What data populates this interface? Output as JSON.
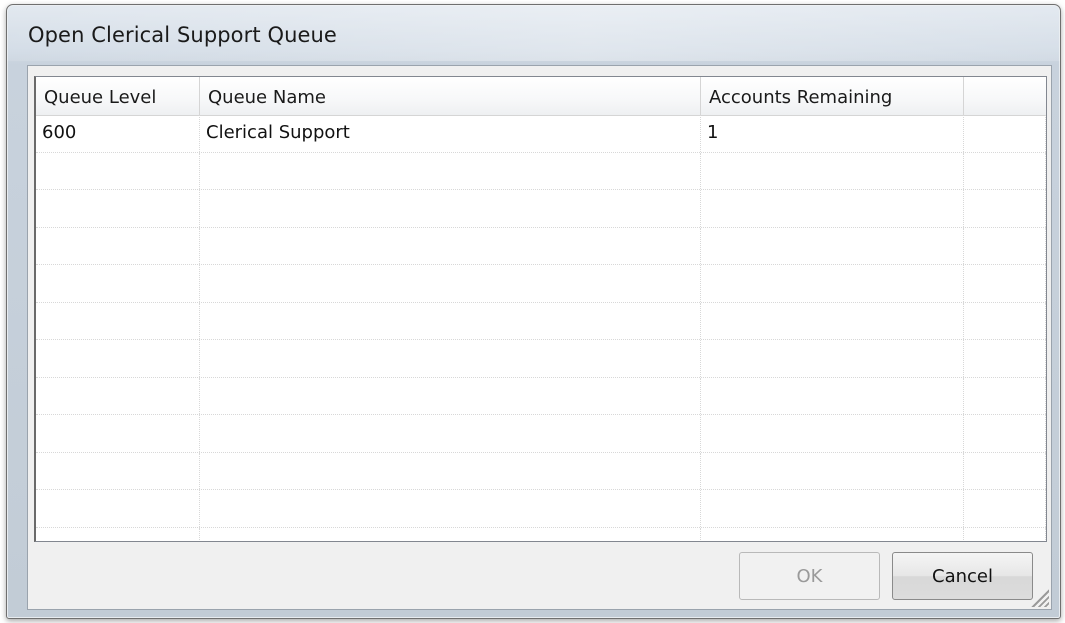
{
  "window": {
    "title": "Open Clerical Support Queue"
  },
  "table": {
    "columns": [
      "Queue Level",
      "Queue Name",
      "Accounts Remaining",
      ""
    ],
    "rows": [
      [
        "600",
        "Clerical Support",
        "1",
        ""
      ]
    ]
  },
  "buttons": {
    "ok": "OK",
    "cancel": "Cancel"
  },
  "state": {
    "ok_enabled": false
  }
}
